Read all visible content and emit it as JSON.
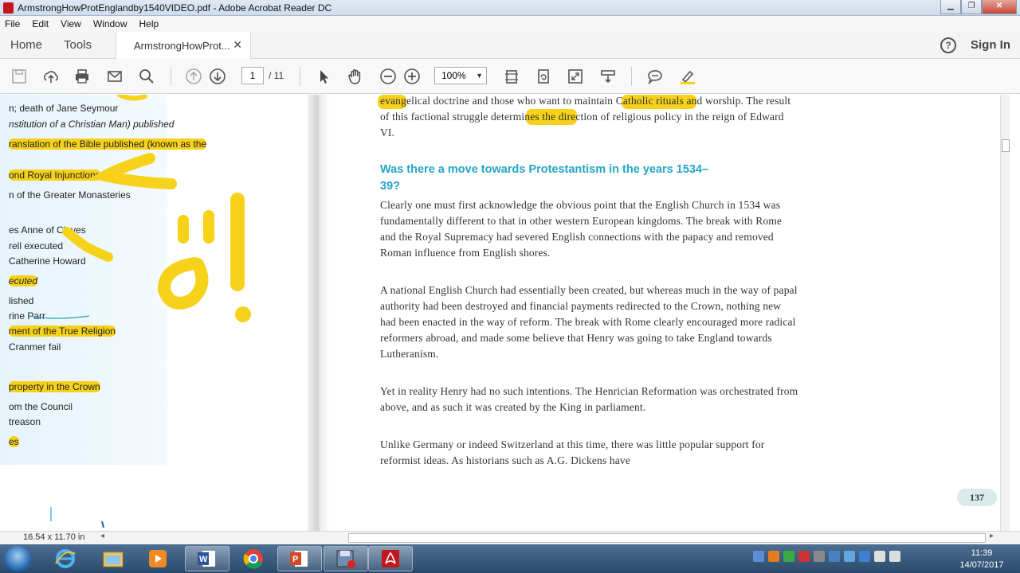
{
  "window": {
    "title": "ArmstrongHowProtEnglandby1540VIDEO.pdf - Adobe Acrobat Reader DC"
  },
  "menu": [
    "File",
    "Edit",
    "View",
    "Window",
    "Help"
  ],
  "nav": {
    "home": "Home",
    "tools": "Tools",
    "doc_tab": "ArmstrongHowProt...",
    "tab_close": "✕",
    "help": "?",
    "sign_in": "Sign In"
  },
  "toolbar": {
    "page_current": "1",
    "page_total": "/ 11",
    "zoom": "100%"
  },
  "left_page": {
    "lines": [
      "n; death of Jane Seymour",
      "nstitution of a Christian Man) published",
      "ranslation of the Bible published (known as the",
      "ond Royal Injunctions",
      "n of the Greater Monasteries",
      "es Anne of Cleves",
      "rell executed",
      "Catherine Howard",
      "ecuted",
      "lished",
      "rine Parr",
      "ment of the True Religion",
      "Cranmer fail",
      "property in the Crown",
      "om the Council",
      "treason",
      "es"
    ]
  },
  "right_page": {
    "intro": "evangelical doctrine and those who want to maintain Catholic rituals and worship. The result of this factional struggle determines the direction of religious policy in the reign of Edward VI.",
    "heading": "Was there a move towards Protestantism in the years 1534–39?",
    "p1": "Clearly one must first acknowledge the obvious point that the English Church in 1534 was fundamentally different to that in other western European kingdoms. The break with Rome and the Royal Supremacy had severed English connections with the papacy and removed Roman influence from English shores.",
    "p2": "A national English Church had essentially been created, but whereas much in the way of papal authority had been destroyed and financial payments redirected to the Crown, nothing new had been enacted in the way of reform. The break with Rome clearly encouraged more radical reformers abroad, and made some believe that Henry was going to take England towards Lutheranism.",
    "p3": "Yet in reality Henry had no such intentions. The Henrician Reformation was orchestrated from above, and as such it was created by the King in parliament.",
    "p4": "Unlike Germany or indeed Switzerland at this time, there was little popular support for reformist ideas. As historians such as A.G. Dickens have",
    "page_number": "137"
  },
  "status": {
    "page_size": "16.54 x 11.70 in"
  },
  "clock": {
    "time": "11:39",
    "date": "14/07/2017"
  },
  "colors": {
    "highlight": "#f7d21a",
    "heading": "#25a6c5"
  }
}
